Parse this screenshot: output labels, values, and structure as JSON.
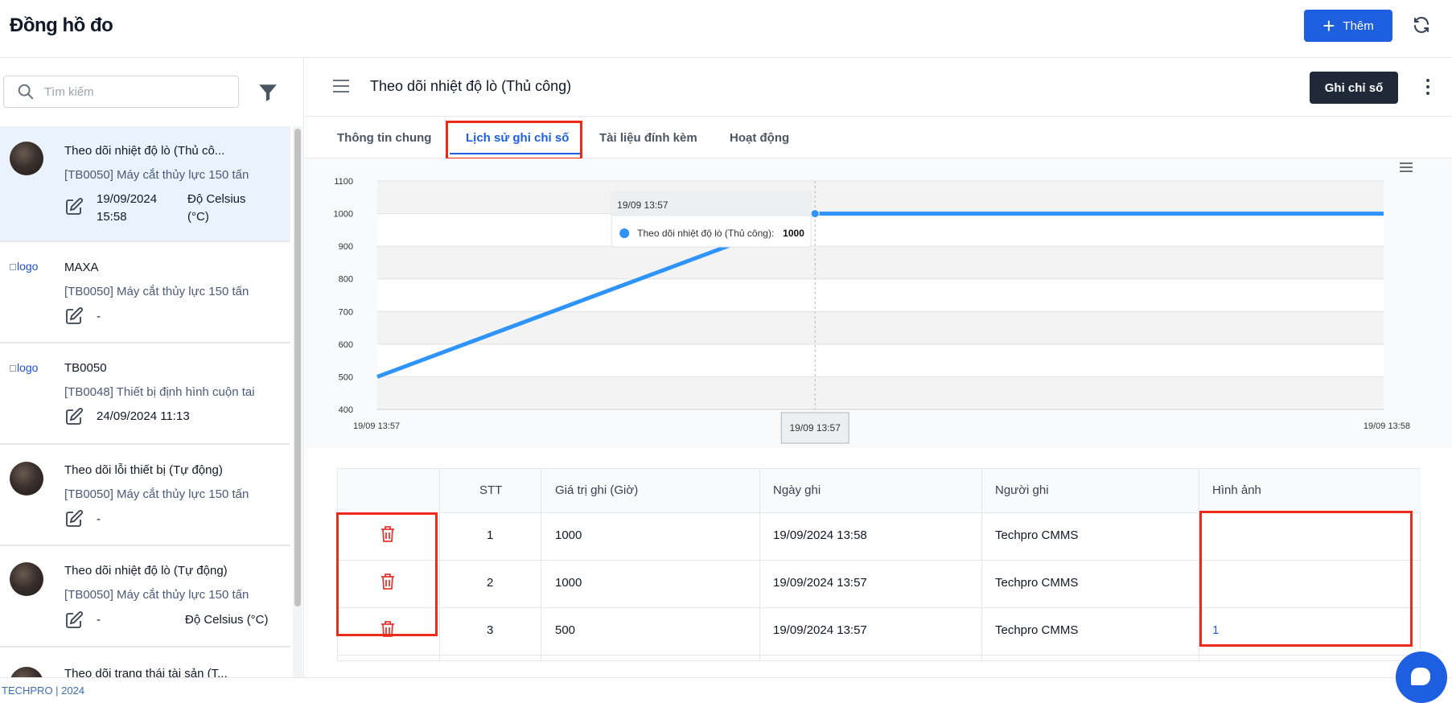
{
  "app": {
    "title": "Đồng hồ đo",
    "add_button": "Thêm",
    "footer": "TECHPRO | 2024"
  },
  "sidebar": {
    "search_placeholder": "Tìm kiếm",
    "items": [
      {
        "title": "Theo dõi nhiệt độ lò (Thủ cô...",
        "subtitle": "[TB0050] Máy cắt thủy lực 150 tấn",
        "date": "19/09/2024 15:58",
        "unit": "Độ Celsius (°C)",
        "image": "avatar"
      },
      {
        "title": "MAXA",
        "subtitle": "[TB0050] Máy cắt thủy lực 150 tấn",
        "date": "-",
        "unit": "",
        "image": "logo",
        "image_alt": "logo"
      },
      {
        "title": "TB0050",
        "subtitle": "[TB0048] Thiết bị định hình cuộn tai",
        "date": "24/09/2024 11:13",
        "unit": "",
        "image": "logo",
        "image_alt": "logo"
      },
      {
        "title": "Theo dõi lỗi thiết bị (Tự động)",
        "subtitle": "[TB0050] Máy cắt thủy lực 150 tấn",
        "date": "-",
        "unit": "",
        "image": "avatar"
      },
      {
        "title": "Theo dõi nhiệt độ lò (Tự động)",
        "subtitle": "[TB0050] Máy cắt thủy lực 150 tấn",
        "date": "-",
        "unit": "Độ Celsius (°C)",
        "image": "avatar"
      },
      {
        "title": "Theo dõi trạng thái tài sản (T...",
        "subtitle": "",
        "date": "",
        "unit": "",
        "image": "avatar"
      }
    ]
  },
  "main": {
    "title": "Theo dõi nhiệt độ lò (Thủ công)",
    "record_button": "Ghi chỉ số",
    "tabs": [
      "Thông tin chung",
      "Lịch sử ghi chỉ số",
      "Tài liệu đính kèm",
      "Hoạt động"
    ],
    "active_tab": 1
  },
  "chart_data": {
    "type": "line",
    "title": "",
    "xlabel": "",
    "ylabel": "",
    "ylim": [
      400,
      1100
    ],
    "yticks": [
      400,
      500,
      600,
      700,
      800,
      900,
      1000,
      1100
    ],
    "x_tick_labels": [
      "19/09 13:57",
      "19/09 13:58"
    ],
    "x": [
      "19/09/2024 13:57",
      "19/09/2024 13:57",
      "19/09/2024 13:58"
    ],
    "series": [
      {
        "name": "Theo dõi nhiệt độ lò (Thủ công)",
        "values": [
          500,
          1000,
          1000
        ],
        "color": "#2e93fa"
      }
    ],
    "tooltip": {
      "header": "19/09 13:57",
      "label": "Theo dõi nhiệt độ lò (Thủ công):",
      "value": "1000"
    },
    "crosshair_label": "19/09 13:57",
    "grid": true
  },
  "table": {
    "headers": [
      "",
      "STT",
      "Giá trị ghi (Giờ)",
      "Ngày ghi",
      "Người ghi",
      "Hình ảnh"
    ],
    "rows": [
      {
        "stt": "1",
        "value": "1000",
        "date": "19/09/2024 13:58",
        "user": "Techpro CMMS",
        "image": ""
      },
      {
        "stt": "2",
        "value": "1000",
        "date": "19/09/2024 13:57",
        "user": "Techpro CMMS",
        "image": ""
      },
      {
        "stt": "3",
        "value": "500",
        "date": "19/09/2024 13:57",
        "user": "Techpro CMMS",
        "image": "1"
      }
    ]
  },
  "colors": {
    "primary": "#1d5fe0",
    "dark_button": "#1f2937",
    "highlight_box": "#ec2b1a",
    "delete_icon": "#e53935",
    "series": "#2e93fa"
  }
}
